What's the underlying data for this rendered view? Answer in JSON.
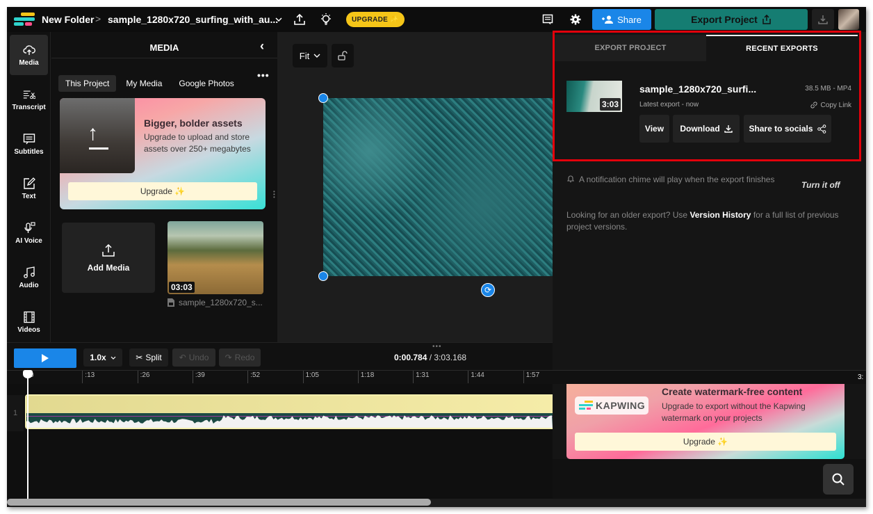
{
  "topbar": {
    "folder": "New Folder",
    "separator": ">",
    "project_name": "sample_1280x720_surfing_with_au...",
    "upgrade_label": "UPGRADE ✨",
    "share_label": "Share",
    "export_label": "Export Project",
    "colors": {
      "brand_blue": "#1a86e8",
      "export_teal": "#157d72",
      "upgrade_yellow": "#f5c518"
    }
  },
  "leftnav": {
    "items": [
      {
        "label": "Media",
        "icon": "cloud-upload-icon",
        "active": true
      },
      {
        "label": "Transcript",
        "icon": "transcript-icon",
        "active": false
      },
      {
        "label": "Subtitles",
        "icon": "subtitles-icon",
        "active": false
      },
      {
        "label": "Text",
        "icon": "text-edit-icon",
        "active": false
      },
      {
        "label": "AI Voice",
        "icon": "microphone-icon",
        "active": false
      },
      {
        "label": "Audio",
        "icon": "music-note-icon",
        "active": false
      },
      {
        "label": "Videos",
        "icon": "film-icon",
        "active": false
      }
    ]
  },
  "media": {
    "title": "MEDIA",
    "tabs": [
      {
        "label": "This Project",
        "active": true
      },
      {
        "label": "My Media",
        "active": false
      },
      {
        "label": "Google Photos",
        "active": false
      }
    ],
    "promo": {
      "heading": "Bigger, bolder assets",
      "body": "Upgrade to upload and store assets over 250+ megabytes",
      "button": "Upgrade ✨"
    },
    "add_media_label": "Add Media",
    "items": [
      {
        "duration": "03:03",
        "name": "sample_1280x720_s..."
      }
    ]
  },
  "canvas": {
    "zoom_label": "Fit"
  },
  "export_panel": {
    "tabs": [
      {
        "label": "EXPORT PROJECT",
        "active": false
      },
      {
        "label": "RECENT EXPORTS",
        "active": true
      }
    ],
    "recent": {
      "name": "sample_1280x720_surfi...",
      "duration": "3:03",
      "size": "38.5 MB - MP4",
      "meta": "Latest export - now",
      "copy_link": "Copy Link",
      "buttons": {
        "view": "View",
        "download": "Download",
        "share": "Share to socials"
      }
    },
    "notification": "A notification chime will play when the export finishes",
    "turn_off": "Turn it off",
    "older_prefix": "Looking for an older export? Use ",
    "older_link": "Version History",
    "older_suffix": " for a full list of previous project versions.",
    "watermark_promo": {
      "logo_text": "KAPWING",
      "heading": "Create watermark-free content",
      "body": "Upgrade to export without the Kapwing watermark on your projects",
      "button": "Upgrade ✨"
    }
  },
  "timeline": {
    "speed": "1.0x",
    "split": "Split",
    "undo": "Undo",
    "redo": "Redo",
    "current_time": "0:00.784",
    "time_separator": " / ",
    "total_time": "3:03.168",
    "ticks": [
      "0",
      ":13",
      ":26",
      ":39",
      ":52",
      "1:05",
      "1:18",
      "1:31",
      "1:44",
      "1:57"
    ],
    "right_tick_fragment": "3:",
    "track_number": "1"
  }
}
